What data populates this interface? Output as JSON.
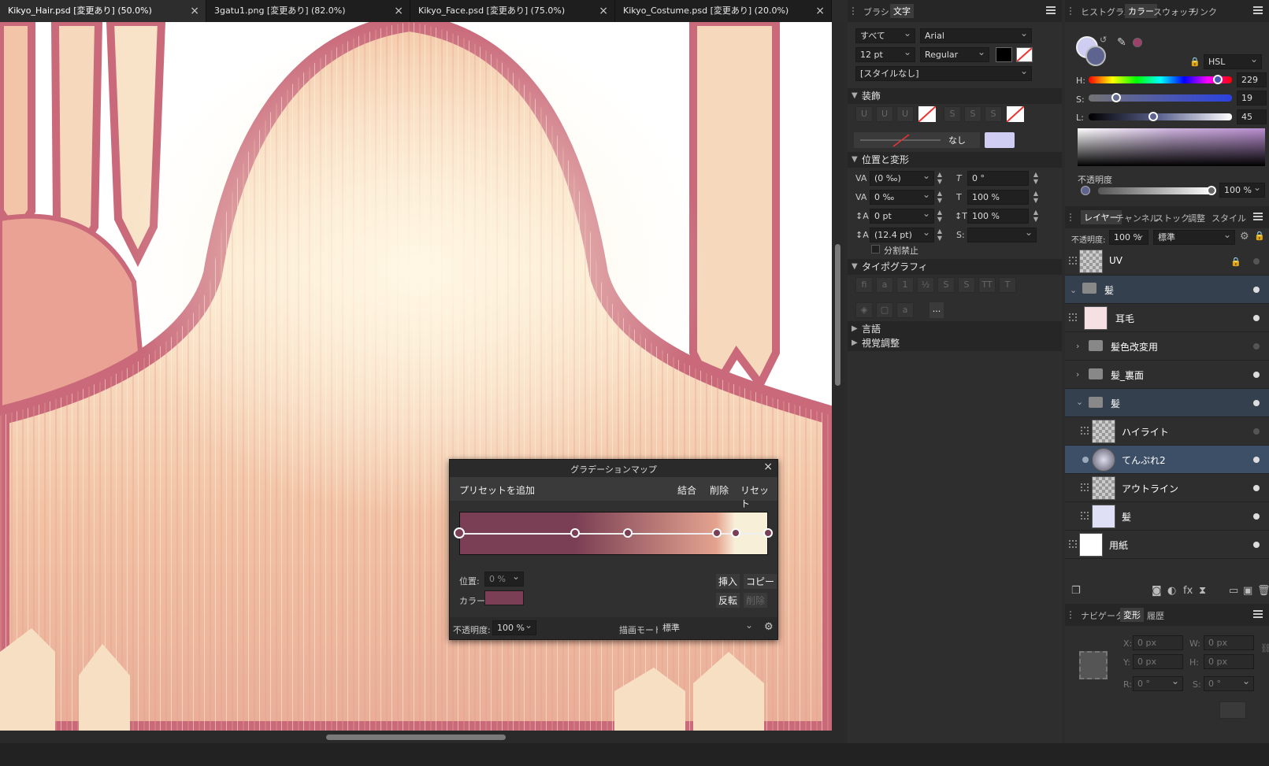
{
  "tabs": [
    {
      "label": "Kikyo_Hair.psd [変更あり] (50.0%)"
    },
    {
      "label": "3gatu1.png [変更あり] (82.0%)"
    },
    {
      "label": "Kikyo_Face.psd [変更あり] (75.0%)"
    },
    {
      "label": "Kikyo_Costume.psd [変更あり] (20.0%)"
    }
  ],
  "close_glyph": "×",
  "text_panel": {
    "tabs": [
      "ブラシ",
      "文字"
    ],
    "scope": "すべて",
    "font": "Arial",
    "size": "12 pt",
    "weight": "Regular",
    "style": "[スタイルなし]",
    "sections": {
      "decoration": "装飾",
      "position": "位置と変形",
      "typography": "タイポグラフィ",
      "language": "言語",
      "visual": "視覚調整"
    },
    "underline_label": "なし",
    "tracking": "(0 ‰)",
    "kerning": "0 ‰",
    "baseline": "0 pt",
    "leading": "(12.4 pt)",
    "shear": "0 °",
    "h_scale": "100 %",
    "v_scale": "100 %",
    "no_break": "分割禁止",
    "more": "..."
  },
  "color_panel": {
    "tabs": [
      "ヒストグラム",
      "カラー",
      "スウォッチ",
      "リンク"
    ],
    "model": "HSL",
    "h_label": "H:",
    "h": "229",
    "s_label": "S:",
    "s": "19",
    "l_label": "L:",
    "l": "45",
    "opacity_label": "不透明度",
    "opacity": "100 %",
    "h_frac": 0.9,
    "s_frac": 0.19,
    "l_frac": 0.45
  },
  "layers_panel": {
    "tabs": [
      "レイヤー",
      "チャンネル",
      "ストック",
      "調整",
      "スタイル"
    ],
    "opacity_label": "不透明度:",
    "opacity": "100 %",
    "blend": "標準",
    "layers": [
      {
        "name": "UV"
      },
      {
        "name": "髪"
      },
      {
        "name": "耳毛"
      },
      {
        "name": "髪色改変用"
      },
      {
        "name": "髪_裏面"
      },
      {
        "name": "髪"
      },
      {
        "name": "ハイライト"
      },
      {
        "name": "てんぷれ2"
      },
      {
        "name": "アウトライン"
      },
      {
        "name": "髪"
      },
      {
        "name": "用紙"
      }
    ]
  },
  "transform_panel": {
    "tabs": [
      "ナビゲータ",
      "変形",
      "履歴"
    ],
    "x_label": "X:",
    "x": "0 px",
    "y_label": "Y:",
    "y": "0 px",
    "w_label": "W:",
    "w": "0 px",
    "h_label": "H:",
    "h": "0 px",
    "r_label": "R:",
    "r": "0 °",
    "s_label": "S:",
    "s": "0 °"
  },
  "gradient_map": {
    "title": "グラデーションマップ",
    "add_preset": "プリセットを追加",
    "merge": "結合",
    "delete": "削除",
    "reset": "リセット",
    "position_label": "位置:",
    "position": "0 %",
    "color_label": "カラー:",
    "insert": "挿入",
    "copy": "コピー",
    "reverse": "反転",
    "delete2": "削除",
    "opacity_label": "不透明度:",
    "opacity": "100 %",
    "blend_label": "描画モード:",
    "blend": "標準",
    "stops": [
      0,
      0.375,
      0.545,
      0.835,
      0.895,
      1.0
    ],
    "colors": {
      "dark": "#7a3f54",
      "mid": "#e4a38f",
      "light": "#f8efd8"
    }
  }
}
